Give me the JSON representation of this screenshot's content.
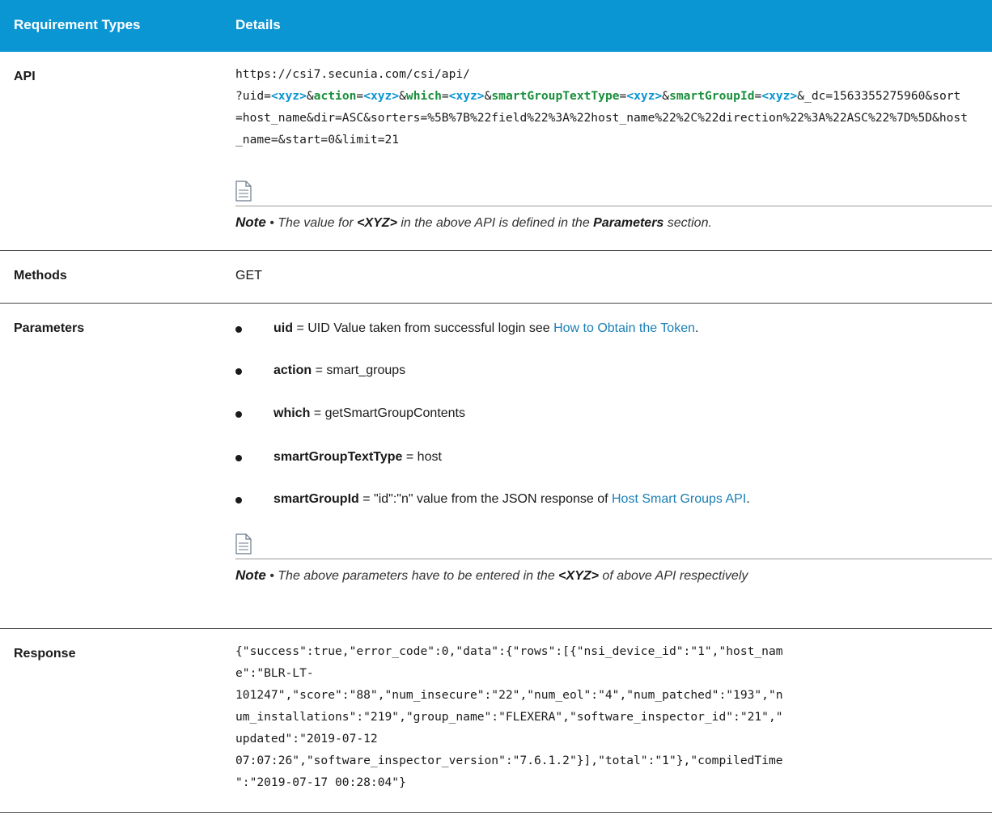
{
  "header": {
    "col1": "Requirement Types",
    "col2": "Details"
  },
  "api_row": {
    "label": "API",
    "url_line1": "https://csi7.secunia.com/csi/api/",
    "seg_uid": "?uid=",
    "token": "<xyz>",
    "amp": "&",
    "eq": "=",
    "k_action": "action",
    "k_which": "which",
    "k_sgtt": "smartGroupTextType",
    "k_sgid": "smartGroupId",
    "tail": "&_dc=1563355275960&sort=host_name&dir=ASC&sorters=%5B%7B%22field%22%3A%22host_name%22%2C%22direction%22%3A%22ASC%22%7D%5D&host_name=&start=0&limit=21",
    "note_bold": "Note",
    "note_sep": " • ",
    "note_pre": "The value for ",
    "note_xyz": "<XYZ>",
    "note_mid": " in the above API is defined in the ",
    "note_params": "Parameters",
    "note_post": " section."
  },
  "methods_row": {
    "label": "Methods",
    "value": "GET"
  },
  "params_row": {
    "label": "Parameters",
    "items": [
      {
        "name": "uid",
        "text": " = UID Value taken from successful login see ",
        "link": "How to Obtain the Token",
        "after": "."
      },
      {
        "name": "action",
        "text": " = smart_groups"
      },
      {
        "name": "which",
        "text": " = getSmartGroupContents"
      },
      {
        "name": "smartGroupTextType",
        "text": " = host"
      },
      {
        "name": "smartGroupId",
        "text": " = \"id\":\"n\" value from the JSON response of ",
        "link": "Host Smart Groups API",
        "after": "."
      }
    ],
    "note_bold": "Note",
    "note_sep": " • ",
    "note_pre": "The above parameters have to be entered in the ",
    "note_xyz": "<XYZ>",
    "note_post": " of above API respectively"
  },
  "response_row": {
    "label": "Response",
    "lines": [
      "{\"success\":true,\"error_code\":0,\"data\":{\"rows\":[{\"nsi_device_id\":\"1\",\"host_nam",
      "e\":\"BLR-LT-",
      "101247\",\"score\":\"88\",\"num_insecure\":\"22\",\"num_eol\":\"4\",\"num_patched\":\"193\",\"n",
      "um_installations\":\"219\",\"group_name\":\"FLEXERA\",\"software_inspector_id\":\"21\",\"",
      "updated\":\"2019-07-12",
      "07:07:26\",\"software_inspector_version\":\"7.6.1.2\"}],\"total\":\"1\"},\"compiledTime",
      "\":\"2019-07-17 00:28:04\"}"
    ]
  },
  "colors": {
    "header_bg": "#0a95d3",
    "key_green": "#1a8f3c",
    "token_blue": "#0a95d3",
    "link": "#1a7fb5"
  },
  "icons": {
    "note": "note-document-icon"
  }
}
